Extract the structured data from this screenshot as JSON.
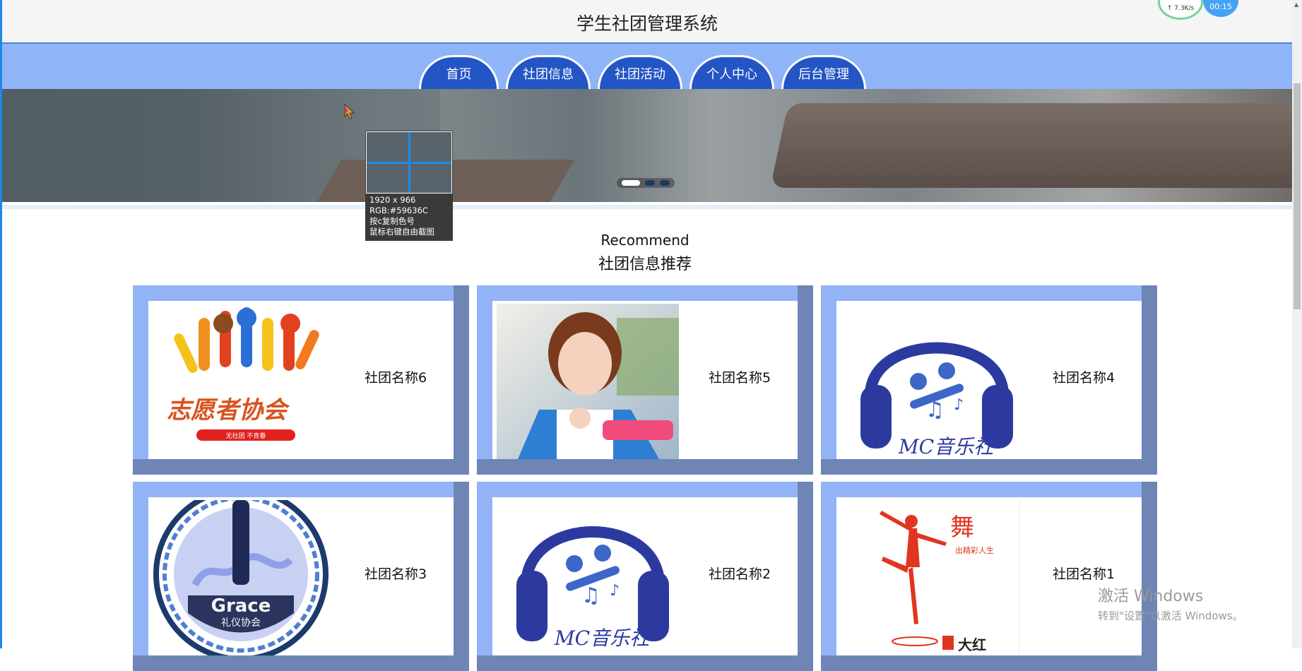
{
  "header": {
    "title": "学生社团管理系统",
    "net_speed": "↑ 7.3K/s",
    "timer": "00:15"
  },
  "nav": {
    "tabs": [
      {
        "label": "首页"
      },
      {
        "label": "社团信息"
      },
      {
        "label": "社团活动"
      },
      {
        "label": "个人中心"
      },
      {
        "label": "后台管理"
      }
    ]
  },
  "carousel": {
    "slide_count": 3,
    "active_index": 0
  },
  "color_picker": {
    "size": "1920 x 966",
    "rgb": "RGB:#59636C",
    "hint_copy": "按c复制色号",
    "hint_capture": "鼠标右键自由截图"
  },
  "recommend": {
    "title_en": "Recommend",
    "title_cn": "社团信息推荐",
    "items": [
      {
        "name": "社团名称6",
        "logo_text": "志愿者协会",
        "logo_sub": "无社团 不青春"
      },
      {
        "name": "社团名称5"
      },
      {
        "name": "社团名称4",
        "logo_text": "MC音乐社"
      },
      {
        "name": "社团名称3",
        "logo_text": "Grace",
        "logo_sub": "礼仪协会"
      },
      {
        "name": "社团名称2",
        "logo_text": "MC音乐社"
      },
      {
        "name": "社团名称1",
        "logo_text": "舞",
        "logo_sub": "出精彩人生",
        "logo_extra": "大红"
      }
    ]
  },
  "watermark": {
    "line1": "激活 Windows",
    "line2": "转到\"设置\"以激活 Windows。"
  },
  "colors": {
    "nav_bg": "#90b4f8",
    "tab_bg": "#2355c4",
    "card_bg": "#92b3f5",
    "card_shade": "#6e85b5"
  }
}
